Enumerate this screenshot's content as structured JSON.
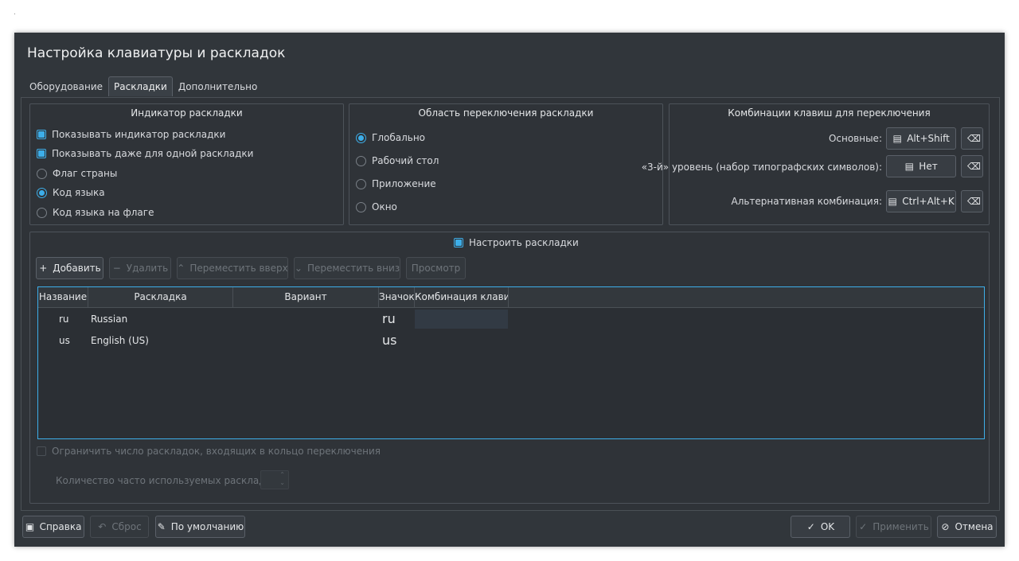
{
  "window": {
    "title": "Настройка клавиатуры и раскладок"
  },
  "tabs": [
    {
      "label": "Оборудование",
      "active": false
    },
    {
      "label": "Раскладки",
      "active": true
    },
    {
      "label": "Дополнительно",
      "active": false
    }
  ],
  "indicator": {
    "title": "Индикатор раскладки",
    "show_indicator": "Показывать индикатор раскладки",
    "show_single": "Показывать даже для одной раскладки",
    "country_flag": "Флаг страны",
    "lang_code": "Код языка",
    "lang_code_flag": "Код языка на флаге"
  },
  "scope": {
    "title": "Область переключения раскладки",
    "global": "Глобально",
    "desktop": "Рабочий стол",
    "application": "Приложение",
    "window": "Окно"
  },
  "shortcuts": {
    "title": "Комбинации клавиш для переключения",
    "main_label": "Основные:",
    "main_value": "Alt+Shift",
    "third_label": "«3-й» уровень (набор типографских символов):",
    "third_value": "Нет",
    "alt_label": "Альтернативная комбинация:",
    "alt_value": "Ctrl+Alt+K"
  },
  "layouts": {
    "configure": "Настроить раскладки",
    "toolbar": {
      "add": "Добавить",
      "remove": "Удалить",
      "move_up": "Переместить вверх",
      "move_down": "Переместить вниз",
      "preview": "Просмотр"
    },
    "columns": [
      "Название",
      "Раскладка",
      "Вариант",
      "Значок",
      "Комбинация клавиш"
    ],
    "rows": [
      {
        "name": "ru",
        "layout": "Russian",
        "variant": "",
        "label": "ru",
        "shortcut": ""
      },
      {
        "name": "us",
        "layout": "English (US)",
        "variant": "",
        "label": "us",
        "shortcut": ""
      }
    ],
    "limit_label": "Ограничить число раскладок, входящих в кольцо переключения",
    "count_label": "Количество часто используемых раскладок:"
  },
  "footer": {
    "help": "Справка",
    "reset": "Сброс",
    "defaults": "По умолчанию",
    "ok": "OK",
    "apply": "Применить",
    "cancel": "Отмена"
  },
  "colors": {
    "accent": "#3daee9",
    "background": "#31363b"
  }
}
